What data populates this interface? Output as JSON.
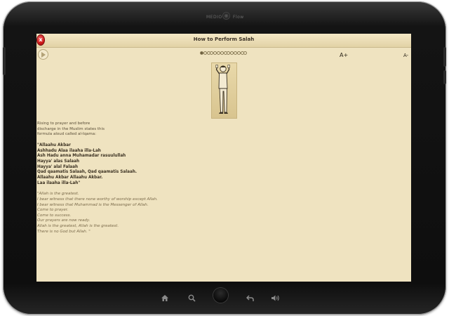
{
  "device": {
    "camera_label_left": "MEDIO",
    "camera_label_right": "Flow"
  },
  "app": {
    "title": "How to Perform Salah",
    "close_label": "x",
    "font_increase_label": "A+",
    "font_decrease_label": "A-",
    "page_indicator": {
      "total": 14,
      "current": 1
    }
  },
  "content": {
    "intro_lines": [
      "Rising to prayer and before",
      "discharge in the Muslim states this",
      "formula aloud called al-Iqama:"
    ],
    "arabic_lines": [
      "\"Allaahu Akbar",
      "Ashhadu Alaa ilaaha illa-Lah",
      "Ash Hadu anna Muhamadar rasuulullah",
      "Hayya' alas Salaah",
      "Hayya' alal Falaah",
      "Qad qaamatis Salaah, Qad qaamatis Salaah.",
      "Allaahu Akbar Allaahu Akbar.",
      "Laa ilaaha illa-Lah\""
    ],
    "translation_lines": [
      "\"Allah is the greatest.",
      "I bear witness that there none worthy of worship except Allah.",
      "I bear witness that Muhammad is the Messenger of Allah.",
      "Come to prayer.",
      "Come to success.",
      "Our prayers are now ready.",
      "Allah is the greatest, Allah is the greatest.",
      "There is no God but Allah. \""
    ]
  },
  "colors": {
    "screen_background": "#efe3c0",
    "titlebar": "#e2d2a6",
    "close_button": "#d21f1f",
    "device_frame": "#141414",
    "nav_icon": "#8a8a8a"
  },
  "icons": {
    "close": "close-icon",
    "play": "play-icon",
    "nav_home": "home-icon",
    "nav_search": "search-icon",
    "nav_back": "back-icon",
    "nav_volume": "volume-icon"
  }
}
